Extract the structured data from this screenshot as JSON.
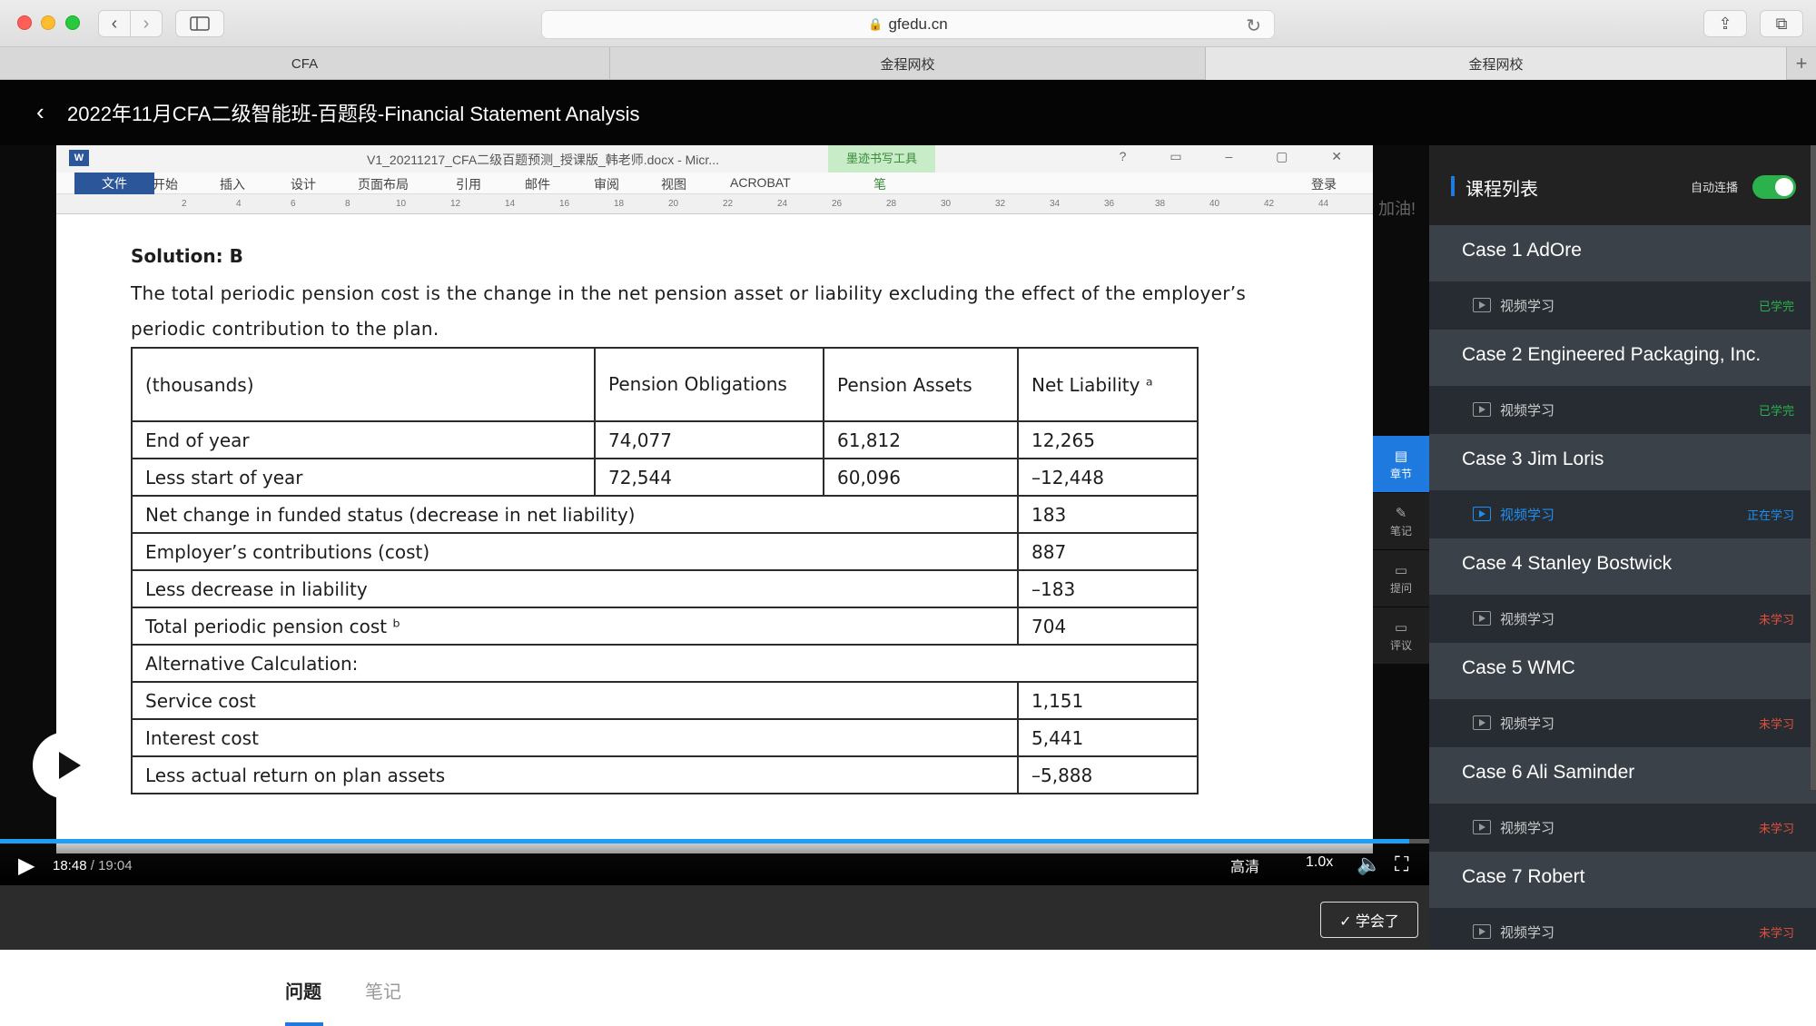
{
  "browser": {
    "url": "gfedu.cn",
    "tabs": [
      "CFA",
      "金程网校",
      "金程网校"
    ]
  },
  "header": {
    "course_title": "2022年11月CFA二级智能班-百题段-Financial Statement Analysis"
  },
  "word": {
    "doc_title": "V1_20211217_CFA二级百题预测_授课版_韩老师.docx - Micr...",
    "tool_tab": "墨迹书写工具",
    "tool_tab_sub": "笔",
    "ribbon_tabs": [
      "文件",
      "开始",
      "插入",
      "设计",
      "页面布局",
      "引用",
      "邮件",
      "审阅",
      "视图",
      "ACROBAT"
    ],
    "login": "登录",
    "ruler_marks": [
      "2",
      "4",
      "6",
      "8",
      "10",
      "12",
      "14",
      "16",
      "18",
      "20",
      "22",
      "24",
      "26",
      "28",
      "30",
      "32",
      "34",
      "36",
      "38",
      "40",
      "42",
      "44"
    ]
  },
  "document": {
    "solution_title": "Solution: B",
    "solution_text": "The total periodic pension cost is the change in the net pension asset or liability excluding the effect of the employer’s periodic contribution to the plan.",
    "table": {
      "headers": [
        "(thousands)",
        "Pension Obligations",
        "Pension Assets",
        "Net Liability ᵃ"
      ],
      "rows3": [
        [
          "End of year",
          "74,077",
          "61,812",
          "12,265"
        ],
        [
          "Less start of year",
          "72,544",
          "60,096",
          "–12,448"
        ]
      ],
      "rows2": [
        [
          "Net change in funded status (decrease in net liability)",
          "183"
        ],
        [
          "Employer’s contributions (cost)",
          "887"
        ],
        [
          "Less decrease in liability",
          "–183"
        ],
        [
          "Total periodic pension cost ᵇ",
          "704"
        ]
      ],
      "alt_header": "Alternative Calculation:",
      "rows_alt": [
        [
          "Service cost",
          "1,151"
        ],
        [
          "Interest cost",
          "5,441"
        ],
        [
          "Less actual return on plan assets",
          "–5,888"
        ]
      ]
    },
    "side_note": "加油!"
  },
  "side_tools": [
    "章节",
    "笔记",
    "提问",
    "评议"
  ],
  "player": {
    "current_time": "18:48",
    "duration": "19:04",
    "progress": 0.986,
    "quality": "高清",
    "speed": "1.0x",
    "learned_label": "✓ 学会了"
  },
  "course_list": {
    "title": "课程列表",
    "autoplay_label": "自动连播",
    "autoplay_on": true,
    "cases": [
      {
        "title": "Case 1 AdOre",
        "item": "视频学习",
        "status": "已学完",
        "state": "done"
      },
      {
        "title": "Case 2 Engineered Packaging, Inc.",
        "item": "视频学习",
        "status": "已学完",
        "state": "done"
      },
      {
        "title": "Case 3 Jim Loris",
        "item": "视频学习",
        "status": "正在学习",
        "state": "now"
      },
      {
        "title": "Case 4 Stanley Bostwick",
        "item": "视频学习",
        "status": "未学习",
        "state": "todo"
      },
      {
        "title": "Case 5 WMC",
        "item": "视频学习",
        "status": "未学习",
        "state": "todo"
      },
      {
        "title": "Case 6 Ali Saminder",
        "item": "视频学习",
        "status": "未学习",
        "state": "todo"
      },
      {
        "title": "Case 7 Robert",
        "item": "视频学习",
        "status": "未学习",
        "state": "todo"
      }
    ]
  },
  "bottom_tabs": [
    "问题",
    "笔记"
  ]
}
